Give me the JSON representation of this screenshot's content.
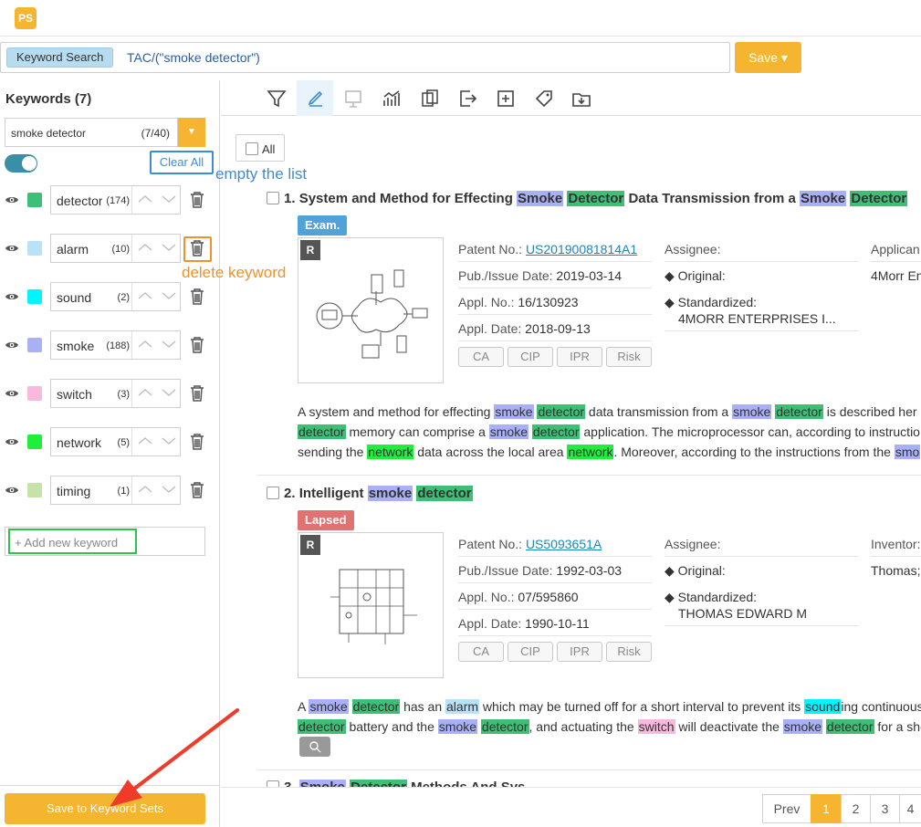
{
  "app": {
    "logo": "PS"
  },
  "search": {
    "tag": "Keyword Search",
    "query": "TAC/(\"smoke detector\")",
    "save_label": "Save ▾"
  },
  "keywords": {
    "title": "Keywords (7)",
    "selected": "smoke detector",
    "selected_count": "(7/40)",
    "clear_all": "Clear All",
    "add_placeholder": "+ Add new keyword",
    "save_sets": "Save to Keyword Sets",
    "items": [
      {
        "name": "detector",
        "count": "(174)",
        "color": "#3dbf75"
      },
      {
        "name": "alarm",
        "count": "(10)",
        "color": "#b8e3f7"
      },
      {
        "name": "sound",
        "count": "(2)",
        "color": "#00f5ff"
      },
      {
        "name": "smoke",
        "count": "(188)",
        "color": "#aab0f5"
      },
      {
        "name": "switch",
        "count": "(3)",
        "color": "#f9b9de"
      },
      {
        "name": "network",
        "count": "(5)",
        "color": "#1fef3c"
      },
      {
        "name": "timing",
        "count": "(1)",
        "color": "#c5e3a8"
      }
    ]
  },
  "toolbar": {
    "icons": [
      "filter-icon",
      "highlighter-icon",
      "presentation-icon",
      "chart-icon",
      "compare-icon",
      "export-icon",
      "add-icon",
      "tag-icon",
      "folder-icon"
    ]
  },
  "results": {
    "all_label": "All",
    "r1": {
      "number": "1.",
      "title_parts": [
        "System and Method for Effecting ",
        "Smoke",
        "Detector",
        " Data Transmission from a ",
        "Smoke",
        "Detector"
      ],
      "status": "Exam.",
      "thumb": "R",
      "patent_label": "Patent No.:",
      "patent": "US20190081814A1",
      "pub_label": "Pub./Issue Date:",
      "pub": "2019-03-14",
      "appl_label": "Appl. No.:",
      "appl": "16/130923",
      "appl_date_label": "Appl. Date:",
      "appl_date": "2018-09-13",
      "assignee_label": "Assignee:",
      "original_label": "Original:",
      "standardized_label": "Standardized:",
      "standardized": "4MORR ENTERPRISES I...",
      "applicant_label": "Applican",
      "applicant": "4Morr En",
      "pills": [
        "CA",
        "CIP",
        "IPR",
        "Risk"
      ],
      "abstract": [
        [
          "A system and method for effecting ",
          "smoke",
          "detector",
          " data transmission from a ",
          "smoke",
          "detector",
          " is described her"
        ],
        [
          "detector",
          " memory can comprise a ",
          "smoke",
          "detector",
          " application. The microprocessor can, according to instructio"
        ],
        [
          "sending the ",
          "network",
          " data across the local area ",
          "network",
          ". Moreover, according to the instructions from the ",
          "smo"
        ]
      ]
    },
    "r2": {
      "number": "2.",
      "title_parts": [
        "Intelligent ",
        "smoke",
        "detector"
      ],
      "status": "Lapsed",
      "thumb": "R",
      "patent_label": "Patent No.:",
      "patent": "US5093651A",
      "pub_label": "Pub./Issue Date:",
      "pub": "1992-03-03",
      "appl_label": "Appl. No.:",
      "appl": "07/595860",
      "appl_date_label": "Appl. Date:",
      "appl_date": "1990-10-11",
      "assignee_label": "Assignee:",
      "original_label": "Original:",
      "standardized_label": "Standardized:",
      "standardized": "THOMAS EDWARD M",
      "inventor_label": "Inventor:",
      "inventor": "Thomas;",
      "pills": [
        "CA",
        "CIP",
        "IPR",
        "Risk"
      ],
      "abstract": [
        [
          "A ",
          "smoke",
          "detector",
          " has an ",
          "alarm",
          " which may be turned off for a short interval to prevent its ",
          "sound",
          "ing continuous"
        ],
        [
          "detector",
          " battery and the ",
          "smoke",
          "detector",
          ", and actuating the ",
          "switch",
          " will deactivate the ",
          "smoke",
          "detector",
          " for a sho"
        ]
      ]
    },
    "r3": {
      "number": "3.",
      "title_parts": [
        "Smoke",
        "Detector",
        " Methods And Sys"
      ]
    }
  },
  "pager": {
    "prev": "Prev",
    "pages": [
      "1",
      "2",
      "3",
      "4"
    ]
  },
  "annotations": {
    "empty_list": "empty the list",
    "delete_keyword": "delete keyword"
  },
  "colors": {
    "accent": "#f5b531",
    "link": "#1a88b5",
    "annot_blue": "#3a8cd9",
    "annot_orange": "#f0922b",
    "arrow": "#f03a2a"
  }
}
